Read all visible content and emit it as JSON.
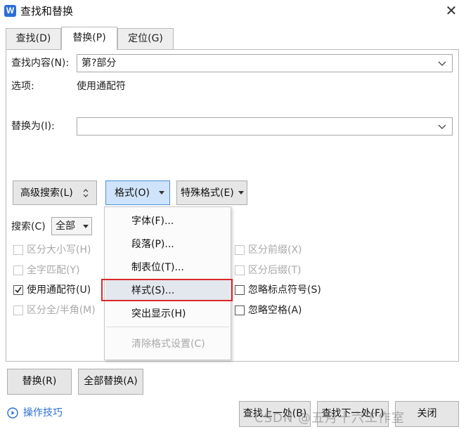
{
  "window": {
    "title": "查找和替换",
    "app_icon": "W"
  },
  "tabs": [
    {
      "label": "查找(D)",
      "active": false
    },
    {
      "label": "替换(P)",
      "active": true
    },
    {
      "label": "定位(G)",
      "active": false
    }
  ],
  "find": {
    "label": "查找内容(N):",
    "value": "第?部分"
  },
  "options": {
    "label": "选项:",
    "value": "使用通配符"
  },
  "replace": {
    "label": "替换为(I):",
    "value": ""
  },
  "buttons": {
    "advanced_search": "高级搜索(L)",
    "format": "格式(O)",
    "special_format": "特殊格式(E)",
    "replace": "替换(R)",
    "replace_all": "全部替换(A)",
    "find_prev": "查找上一处(B)",
    "find_next": "查找下一处(F)",
    "close": "关闭"
  },
  "search": {
    "label": "搜索(C)",
    "value": "全部"
  },
  "checkboxes_left": [
    {
      "label": "区分大小写(H)",
      "checked": false,
      "enabled": false
    },
    {
      "label": "全字匹配(Y)",
      "checked": false,
      "enabled": false
    },
    {
      "label": "使用通配符(U)",
      "checked": true,
      "enabled": true
    },
    {
      "label": "区分全/半角(M)",
      "checked": false,
      "enabled": false
    }
  ],
  "checkboxes_right": [
    {
      "label": "区分前缀(X)",
      "checked": false,
      "enabled": false
    },
    {
      "label": "区分后缀(T)",
      "checked": false,
      "enabled": false
    },
    {
      "label": "忽略标点符号(S)",
      "checked": false,
      "enabled": true
    },
    {
      "label": "忽略空格(A)",
      "checked": false,
      "enabled": true
    }
  ],
  "format_menu": {
    "items": [
      {
        "label": "字体(F)...",
        "enabled": true
      },
      {
        "label": "段落(P)...",
        "enabled": true
      },
      {
        "label": "制表位(T)...",
        "enabled": true
      },
      {
        "label": "样式(S)...",
        "enabled": true,
        "highlighted": true
      },
      {
        "label": "突出显示(H)",
        "enabled": true
      },
      {
        "label": "清除格式设置(C)",
        "enabled": false
      }
    ]
  },
  "tips": {
    "label": "操作技巧"
  },
  "watermark": "CSDN @五月十六工作室",
  "colors": {
    "accent": "#2b6fd6",
    "highlight_box": "#d9282c",
    "pressed_button": "#cfe3fb"
  }
}
